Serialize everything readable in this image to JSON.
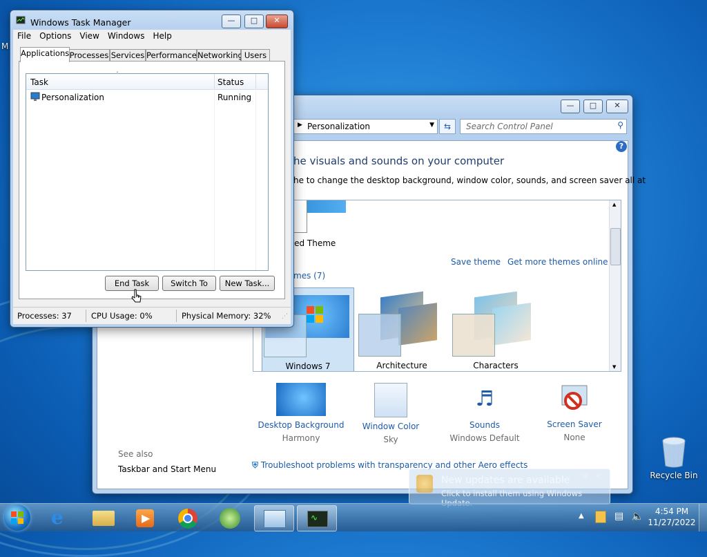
{
  "colors": {
    "link": "#1e5aa8",
    "accent": "#1d7bd1",
    "heading": "#1e3e6e"
  },
  "control_panel": {
    "address": "Personalization",
    "search_placeholder": "Search Control Panel",
    "heading": "he visuals and sounds on your computer",
    "subheading": "he to change the desktop background, window color, sounds, and screen saver all at",
    "unsaved_theme": "ved Theme",
    "save_theme": "Save theme",
    "more_themes": "Get more themes online",
    "aero_themes": "mes (7)",
    "themes": [
      {
        "name": "Windows 7",
        "selected": true
      },
      {
        "name": "Architecture",
        "selected": false
      },
      {
        "name": "Characters",
        "selected": false
      }
    ],
    "settings": [
      {
        "title": "Desktop Background",
        "value": "Harmony",
        "icon": "desktop-background-icon"
      },
      {
        "title": "Window Color",
        "value": "Sky",
        "icon": "window-color-icon"
      },
      {
        "title": "Sounds",
        "value": "Windows Default",
        "icon": "sounds-icon"
      },
      {
        "title": "Screen Saver",
        "value": "None",
        "icon": "screen-saver-icon"
      }
    ],
    "troubleshoot": "Troubleshoot problems with transparency and other Aero effects",
    "see_also": "See also",
    "see_also_link": "Taskbar and Start Menu"
  },
  "task_manager": {
    "title": "Windows Task Manager",
    "menu": [
      "File",
      "Options",
      "View",
      "Windows",
      "Help"
    ],
    "tabs": [
      "Applications",
      "Processes",
      "Services",
      "Performance",
      "Networking",
      "Users"
    ],
    "columns": [
      "Task",
      "Status"
    ],
    "rows": [
      {
        "task": "Personalization",
        "status": "Running"
      }
    ],
    "buttons": {
      "end_task": "End Task",
      "switch_to": "Switch To",
      "new_task": "New Task..."
    },
    "status": {
      "processes": "Processes: 37",
      "cpu": "CPU Usage: 0%",
      "memory": "Physical Memory: 32%"
    }
  },
  "desktop": {
    "recycle_bin": "Recycle Bin",
    "edge_letter": "M"
  },
  "notification": {
    "title": "New updates are available",
    "body": "Click to install them using Windows Update."
  },
  "taskbar": {
    "time": "4:54 PM",
    "date": "11/27/2022"
  }
}
